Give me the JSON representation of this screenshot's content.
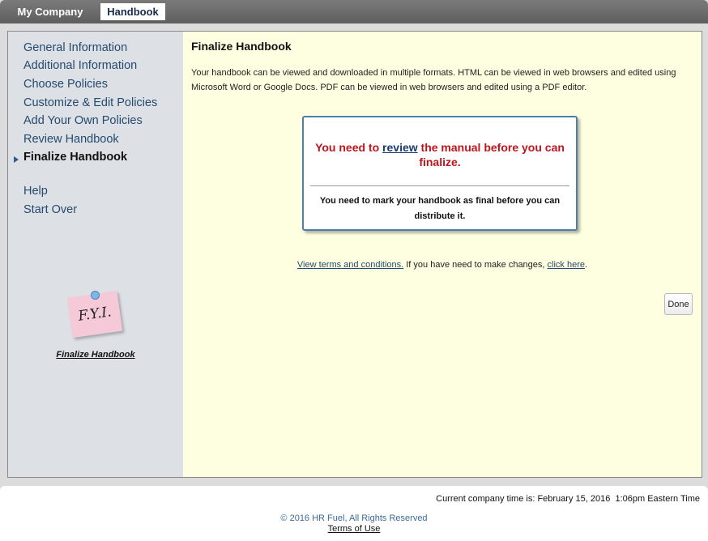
{
  "tabs": {
    "my_company": "My Company",
    "handbook": "Handbook"
  },
  "sidebar": {
    "items": [
      {
        "label": "General Information"
      },
      {
        "label": "Additional Information"
      },
      {
        "label": "Choose Policies"
      },
      {
        "label": "Customize & Edit Policies"
      },
      {
        "label": "Add Your Own Policies"
      },
      {
        "label": "Review Handbook"
      },
      {
        "label": "Finalize Handbook"
      }
    ],
    "help": "Help",
    "start_over": "Start Over",
    "fyi_note": "F.Y.I.",
    "fyi_link": "Finalize Handbook"
  },
  "main": {
    "title": "Finalize Handbook",
    "intro": "Your handbook can be viewed and downloaded in multiple formats. HTML can be viewed in web browsers and edited using Microsoft Word or Google Docs. PDF can be viewed in web browsers and edited using a PDF editor.",
    "message": {
      "prefix": "You need to ",
      "link": "review",
      "suffix": " the manual before you can finalize.",
      "sub": "You need to mark your handbook as final before you can distribute it."
    },
    "terms_link": "View terms and conditions.",
    "terms_middle": " If you have need to make changes, ",
    "click_here": "click here",
    "terms_end": ".",
    "done_label": "Done"
  },
  "footer": {
    "company_time": "Current company time is: February 15, 2016  1:06pm Eastern Time",
    "copyright": "© 2016 HR Fuel, All Rights Reserved",
    "terms_of_use": "Terms of Use"
  },
  "colors": {
    "accent": "#254a6e",
    "alert": "#c0141c",
    "content_bg": "#fefee0",
    "sidebar_bg": "#dde1e6"
  }
}
